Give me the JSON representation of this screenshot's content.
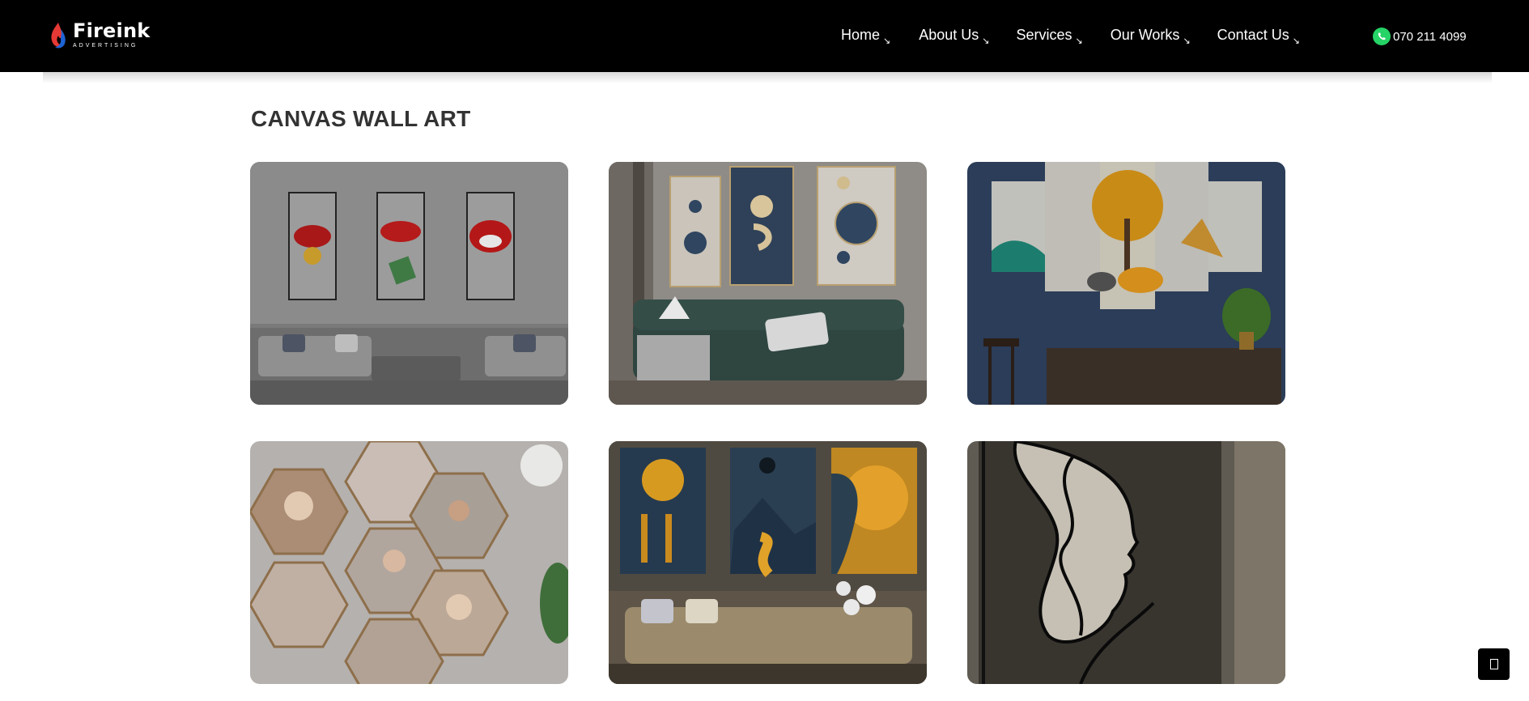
{
  "brand": {
    "name": "Fireink",
    "tagline": "ADVERTISING",
    "primary_color": "#000000",
    "flame_red": "#e53935",
    "flame_blue": "#1e63d6"
  },
  "nav": [
    {
      "label": "Home",
      "arrow": "↘"
    },
    {
      "label": "About Us",
      "arrow": "↘"
    },
    {
      "label": "Services",
      "arrow": "↘"
    },
    {
      "label": "Our Works",
      "arrow": "↘"
    },
    {
      "label": "Contact Us",
      "arrow": "↘"
    }
  ],
  "contact": {
    "phone": "070 211 4099",
    "icon": "whatsapp-icon",
    "icon_color": "#25d366"
  },
  "page": {
    "title": "CANVAS WALL ART"
  },
  "gallery": [
    {
      "name": "lips-triptych"
    },
    {
      "name": "geometric-frames-living-room"
    },
    {
      "name": "golden-tree-panorama"
    },
    {
      "name": "family-hexagon-collage"
    },
    {
      "name": "abstract-moon-triptych"
    },
    {
      "name": "line-art-face"
    }
  ],
  "scroll_button": {
    "icon": "square-icon"
  }
}
